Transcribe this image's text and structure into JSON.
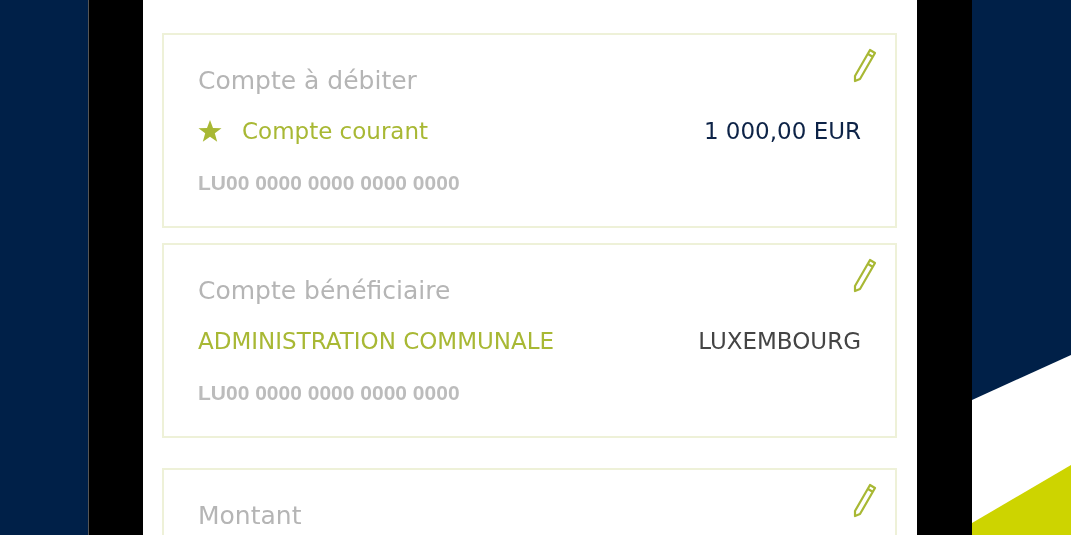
{
  "cards": [
    {
      "label": "Compte à débiter",
      "favorite": true,
      "name": "Compte courant",
      "detail": "1 000,00 EUR",
      "kind": "amount",
      "iban": "LU00 0000 0000 0000 0000"
    },
    {
      "label": "Compte bénéficiaire",
      "favorite": false,
      "name": "ADMINISTRATION COMMUNALE",
      "detail": "LUXEMBOURG",
      "kind": "city",
      "iban": "LU00 0000 0000 0000 0000"
    },
    {
      "label": "Montant"
    }
  ]
}
